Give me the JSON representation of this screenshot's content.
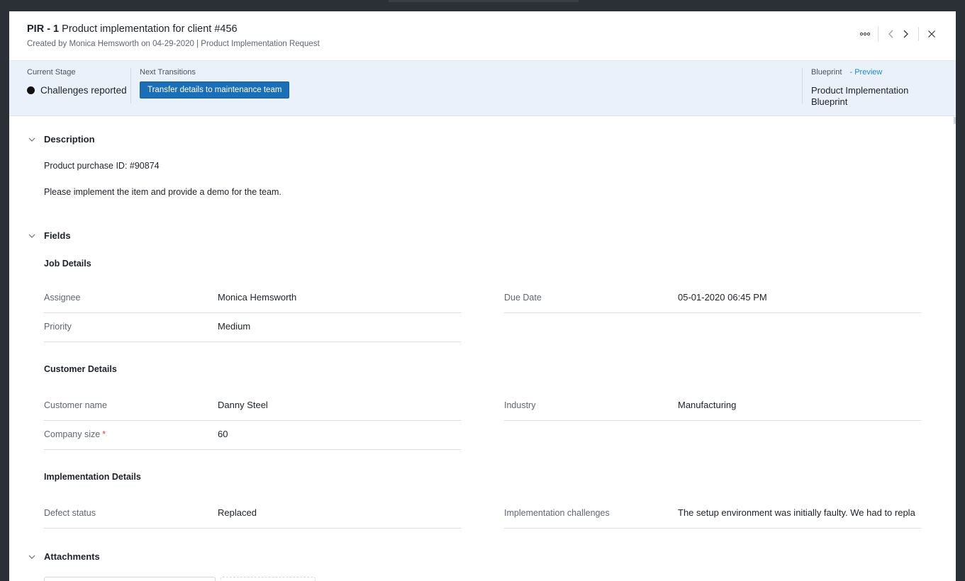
{
  "header": {
    "code": "PIR - 1",
    "title": "Product implementation for client #456",
    "created_prefix": "Created by",
    "created_by": "Monica Hemsworth",
    "created_on": "on 04-29-2020",
    "request_type": "| Product Implementation Request",
    "icons": [
      "more-icon",
      "prev-icon",
      "next-icon",
      "close-icon"
    ]
  },
  "stage": {
    "current_label": "Current Stage",
    "current_value": "Challenges reported",
    "next_label": "Next Transitions",
    "transition_button": "Transfer details to maintenance team",
    "blueprint_label": "Blueprint",
    "blueprint_preview": "- Preview",
    "blueprint_value": "Product Implementation Blueprint"
  },
  "description": {
    "heading": "Description",
    "lines": [
      "Product purchase ID: #90874",
      "Please implement the item and provide a demo for the team."
    ]
  },
  "fields": {
    "heading": "Fields",
    "job": {
      "title": "Job Details",
      "assignee_label": "Assignee",
      "assignee_value": "Monica Hemsworth",
      "due_label": "Due Date",
      "due_value": "05-01-2020 06:45 PM",
      "priority_label": "Priority",
      "priority_value": "Medium"
    },
    "customer": {
      "title": "Customer Details",
      "name_label": "Customer name",
      "name_value": "Danny Steel",
      "industry_label": "Industry",
      "industry_value": "Manufacturing",
      "size_label": "Company size",
      "size_required": "*",
      "size_value": "60"
    },
    "implementation": {
      "title": "Implementation Details",
      "defect_label": "Defect status",
      "defect_value": "Replaced",
      "challenges_label": "Implementation challenges",
      "challenges_value": "The setup environment was initially faulty. We had to replac"
    }
  },
  "attachments": {
    "heading": "Attachments"
  },
  "colors": {
    "accent": "#1b6fb8",
    "stage_bar": "#eaf1fa",
    "link": "#1a8ad1",
    "required": "#e0453c"
  }
}
